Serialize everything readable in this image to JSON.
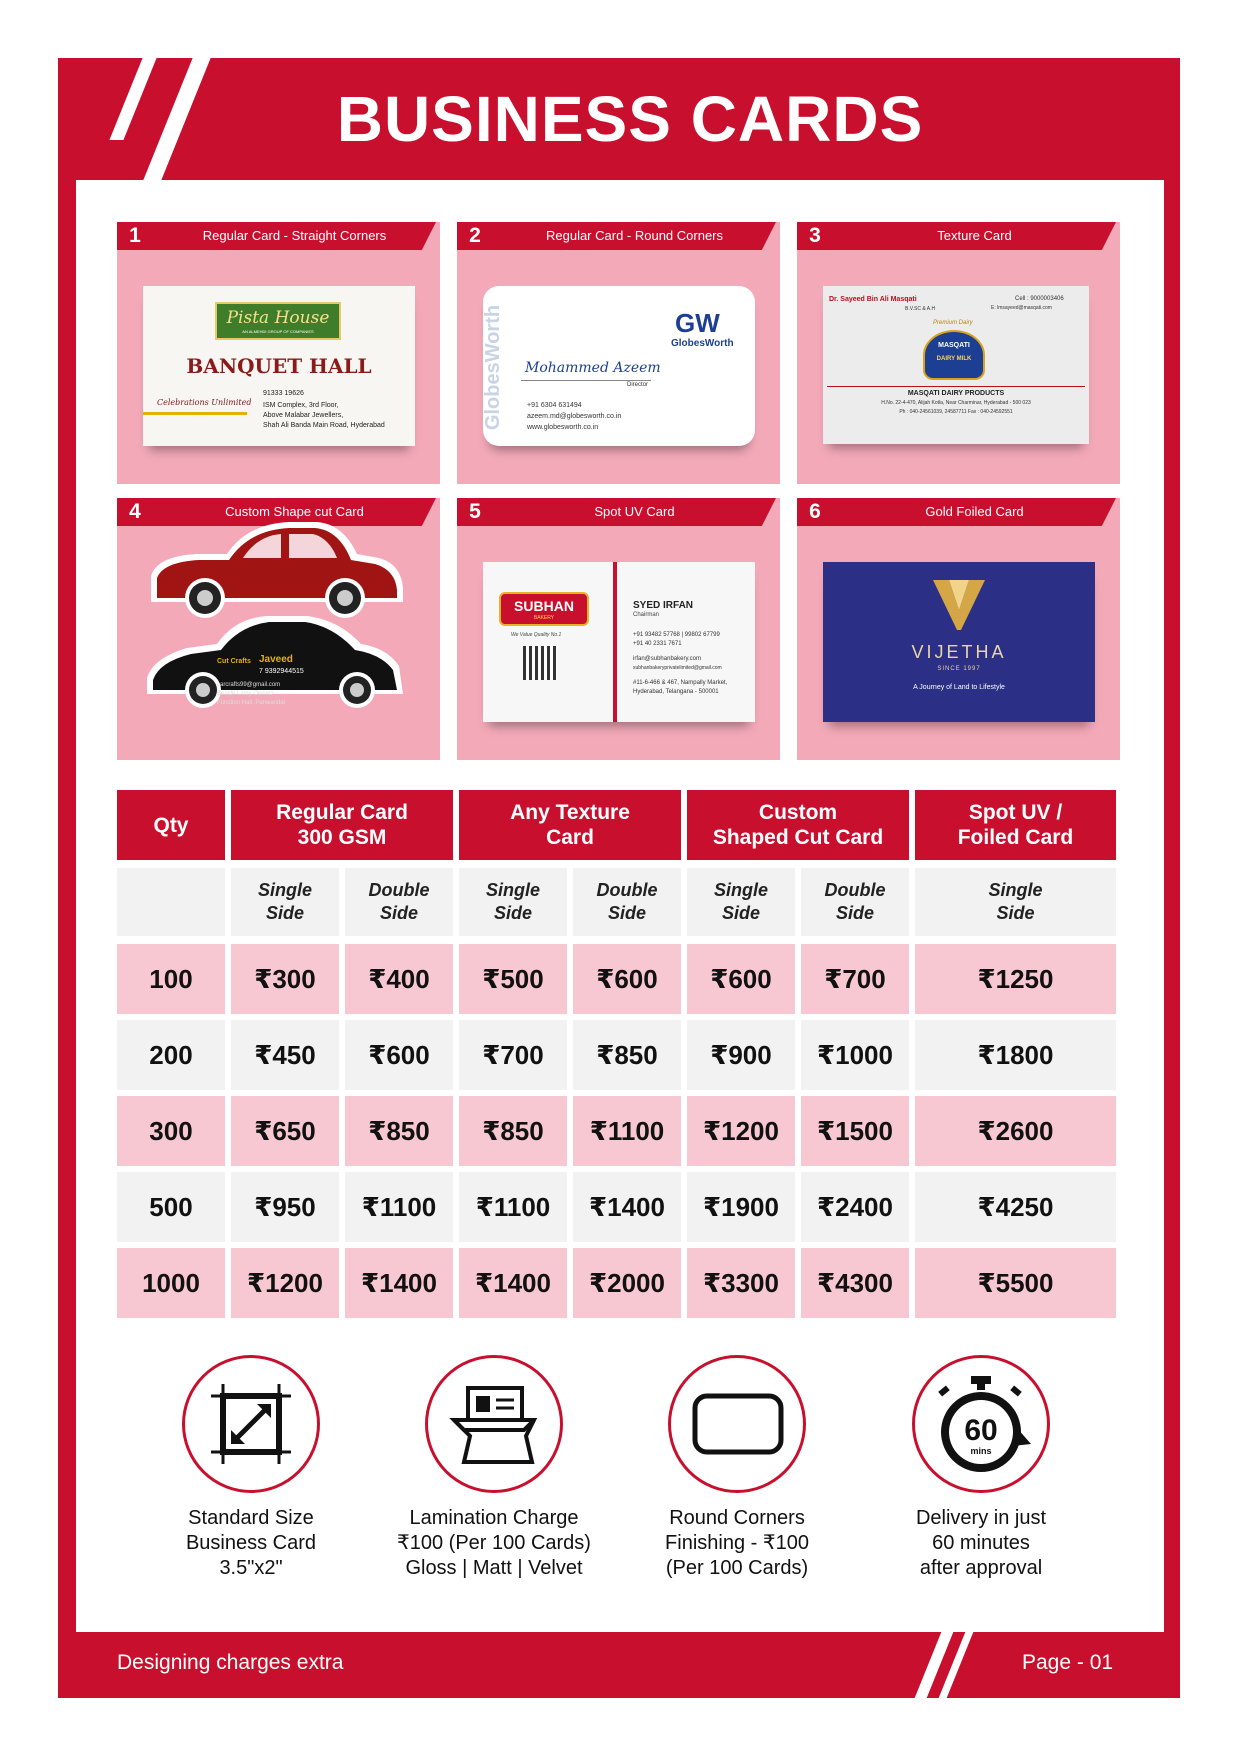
{
  "header": {
    "title": "BUSINESS CARDS"
  },
  "panels": [
    {
      "num": "1",
      "label": "Regular Card - Straight Corners"
    },
    {
      "num": "2",
      "label": "Regular Card - Round Corners"
    },
    {
      "num": "3",
      "label": "Texture Card"
    },
    {
      "num": "4",
      "label": "Custom Shape cut Card"
    },
    {
      "num": "5",
      "label": "Spot UV Card"
    },
    {
      "num": "6",
      "label": "Gold Foiled Card"
    }
  ],
  "samples": {
    "c1": {
      "brand": "Pista House",
      "tagline": "AN ALMEHDI GROUP OF COMPANIES",
      "heading": "BANQUET HALL",
      "slogan": "Celebrations Unlimited",
      "phone": "91333 19626",
      "addr1": "ISM Complex, 3rd Floor,",
      "addr2": "Above Malabar Jewellers,",
      "addr3": "Shah Ali Banda Main Road, Hyderabad"
    },
    "c2": {
      "logo": "GW",
      "brand": "GlobesWorth",
      "name": "Mohammed Azeem",
      "role": "Director",
      "phone": "+91 6304 631494",
      "email": "azeem.md@globesworth.co.in",
      "web": "www.globesworth.co.in",
      "side": "GlobesWorth"
    },
    "c3": {
      "name": "Dr. Sayeed Bin Ali Masqati",
      "qual": "B.V.SC & A.H",
      "cell": "Cell : 9000003406",
      "email": "E: lmsayeed@masqati.com",
      "premium": "Premium Dairy",
      "logo": "MASQATI",
      "logo2": "DAIRY MILK",
      "company": "MASQATI DAIRY PRODUCTS",
      "addr": "H.No. 22-4-470, Alijah Kotla, Near Charminar, Hyderabad - 500 023",
      "ph": "Ph : 040-24561039, 24587711 Fax : 040-24592551"
    },
    "c4": {
      "name": "Javeed",
      "brand": "Cut Crafts",
      "phone": "7 9392944515",
      "l1": "carcrafts99@gmail.com",
      "l2": "Beside Lamy Owners",
      "l3": "Function Hall, Panwandal"
    },
    "c5": {
      "brand": "SUBHAN",
      "sub": "BAKERY",
      "quality": "We Value Quality No.1",
      "name": "SYED IRFAN",
      "role": "Chairman",
      "ph1": "+91 93482 57768 | 99802 67799",
      "ph2": "+91 40 2331 7671",
      "mail1": "irfan@subhanbakery.com",
      "mail2": "subhanbakeryprivatelimited@gmail.com",
      "addr1": "#11-6-466 & 467, Nampally Market,",
      "addr2": "Hyderabad, Telangana - 500001"
    },
    "c6": {
      "brand": "VIJETHA",
      "since": "SINCE 1997",
      "tag": "A Journey of Land to Lifestyle"
    }
  },
  "table": {
    "headers": [
      {
        "text": "Qty"
      },
      {
        "line1": "Regular Card",
        "line2": "300 GSM"
      },
      {
        "line1": "Any Texture",
        "line2": "Card"
      },
      {
        "line1": "Custom",
        "line2": "Shaped Cut Card"
      },
      {
        "line1": "Spot UV /",
        "line2": "Foiled Card"
      }
    ],
    "subheaders": [
      {
        "l1": "Single",
        "l2": "Side"
      },
      {
        "l1": "Double",
        "l2": "Side"
      },
      {
        "l1": "Single",
        "l2": "Side"
      },
      {
        "l1": "Double",
        "l2": "Side"
      },
      {
        "l1": "Single",
        "l2": "Side"
      },
      {
        "l1": "Double",
        "l2": "Side"
      },
      {
        "l1": "Single",
        "l2": "Side"
      }
    ],
    "rows": [
      [
        "100",
        "₹300",
        "₹400",
        "₹500",
        "₹600",
        "₹600",
        "₹700",
        "₹1250"
      ],
      [
        "200",
        "₹450",
        "₹600",
        "₹700",
        "₹850",
        "₹900",
        "₹1000",
        "₹1800"
      ],
      [
        "300",
        "₹650",
        "₹850",
        "₹850",
        "₹1100",
        "₹1200",
        "₹1500",
        "₹2600"
      ],
      [
        "500",
        "₹950",
        "₹1100",
        "₹1100",
        "₹1400",
        "₹1900",
        "₹2400",
        "₹4250"
      ],
      [
        "1000",
        "₹1200",
        "₹1400",
        "₹1400",
        "₹2000",
        "₹3300",
        "₹4300",
        "₹5500"
      ]
    ]
  },
  "features": [
    {
      "icon": "resize-icon",
      "l1": "Standard Size",
      "l2": "Business Card",
      "l3": "3.5\"x2\""
    },
    {
      "icon": "lamination-icon",
      "l1": "Lamination Charge",
      "l2": "₹100 (Per 100 Cards)",
      "l3": "Gloss | Matt | Velvet"
    },
    {
      "icon": "rounded-rect-icon",
      "l1": "Round Corners",
      "l2": "Finishing - ₹100",
      "l3": "(Per 100 Cards)"
    },
    {
      "icon": "stopwatch-icon",
      "l1": "Delivery in just",
      "l2": "60 minutes",
      "l3": "after approval",
      "badge": "60",
      "badge_unit": "mins"
    }
  ],
  "footer": {
    "left": "Designing charges extra",
    "right": "Page - 01"
  },
  "colors": {
    "brand_red": "#c8102e",
    "panel_pink": "#f3a9b8",
    "row_pink": "#f8c8d2",
    "row_grey": "#f2f2f2"
  }
}
